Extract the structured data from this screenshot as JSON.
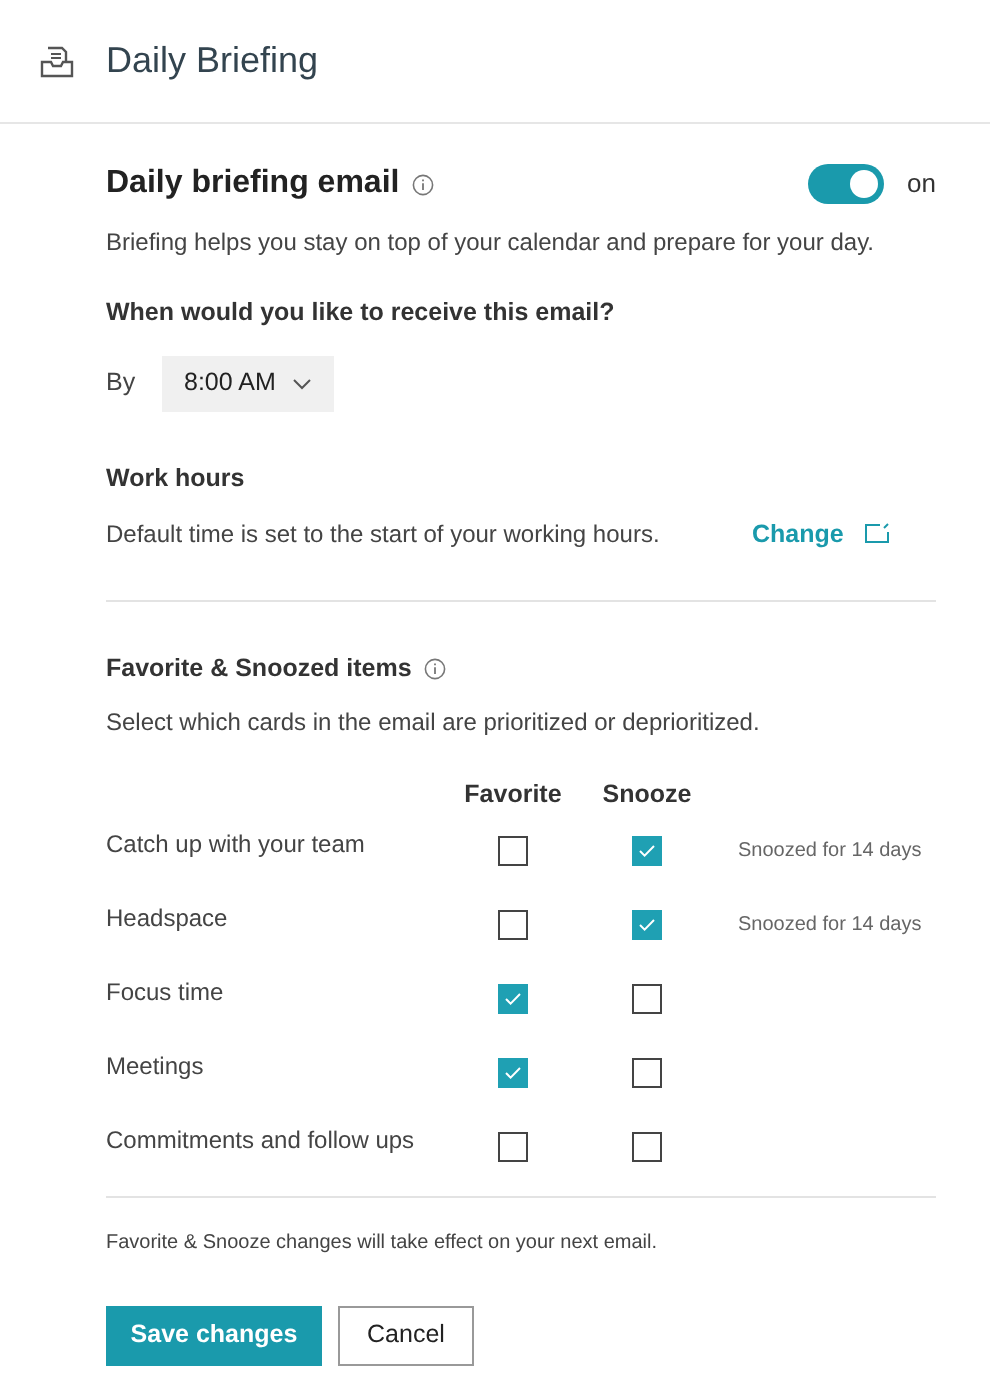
{
  "header": {
    "title": "Daily Briefing"
  },
  "email": {
    "title": "Daily briefing email",
    "on": true,
    "toggle_label": "on",
    "description": "Briefing helps you stay on top of your calendar and prepare for your day."
  },
  "schedule": {
    "question": "When would you like to receive this email?",
    "by_label": "By",
    "time": "8:00 AM"
  },
  "work_hours": {
    "title": "Work hours",
    "description": "Default time is set to the start of your working hours.",
    "link": "Change"
  },
  "items_section": {
    "title": "Favorite & Snoozed items",
    "description": "Select which cards in the email are prioritized or deprioritized.",
    "columns": [
      "Favorite",
      "Snooze"
    ],
    "rows": [
      {
        "label": "Catch up with your team",
        "favorite": false,
        "snooze": true,
        "note": "Snoozed for 14 days"
      },
      {
        "label": "Headspace",
        "favorite": false,
        "snooze": true,
        "note": "Snoozed for 14 days"
      },
      {
        "label": "Focus time",
        "favorite": true,
        "snooze": false
      },
      {
        "label": "Meetings",
        "favorite": true,
        "snooze": false
      },
      {
        "label": "Commitments and follow ups",
        "favorite": false,
        "snooze": false
      }
    ],
    "footnote": "Favorite & Snooze changes will take effect on your next email."
  },
  "buttons": {
    "save": "Save changes",
    "cancel": "Cancel"
  }
}
